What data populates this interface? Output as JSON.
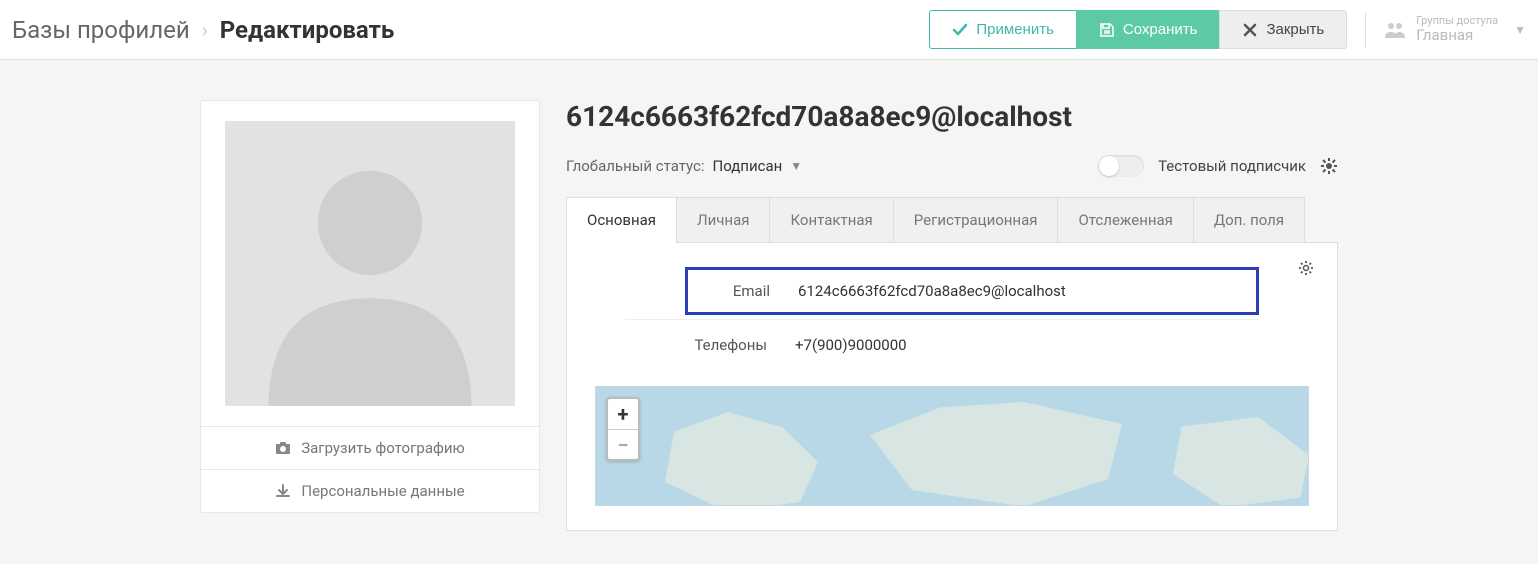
{
  "breadcrumb": {
    "root": "Базы профилей",
    "current": "Редактировать"
  },
  "actions": {
    "apply": "Применить",
    "save": "Сохранить",
    "close": "Закрыть"
  },
  "access": {
    "label": "Группы доступа",
    "value": "Главная"
  },
  "sidebar": {
    "upload": "Загрузить фотографию",
    "personal": "Персональные данные"
  },
  "profile": {
    "title": "6124c6663f62fcd70a8a8ec9@localhost",
    "status_label": "Глобальный статус:",
    "status_value": "Подписан",
    "test_label": "Тестовый подписчик"
  },
  "tabs": {
    "t0": "Основная",
    "t1": "Личная",
    "t2": "Контактная",
    "t3": "Регистрационная",
    "t4": "Отслеженная",
    "t5": "Доп. поля"
  },
  "fields": {
    "email_label": "Email",
    "email_value": "6124c6663f62fcd70a8a8ec9@localhost",
    "phone_label": "Телефоны",
    "phone_value": "+7(900)9000000"
  },
  "map": {
    "zoom_in": "+",
    "zoom_out": "−"
  }
}
